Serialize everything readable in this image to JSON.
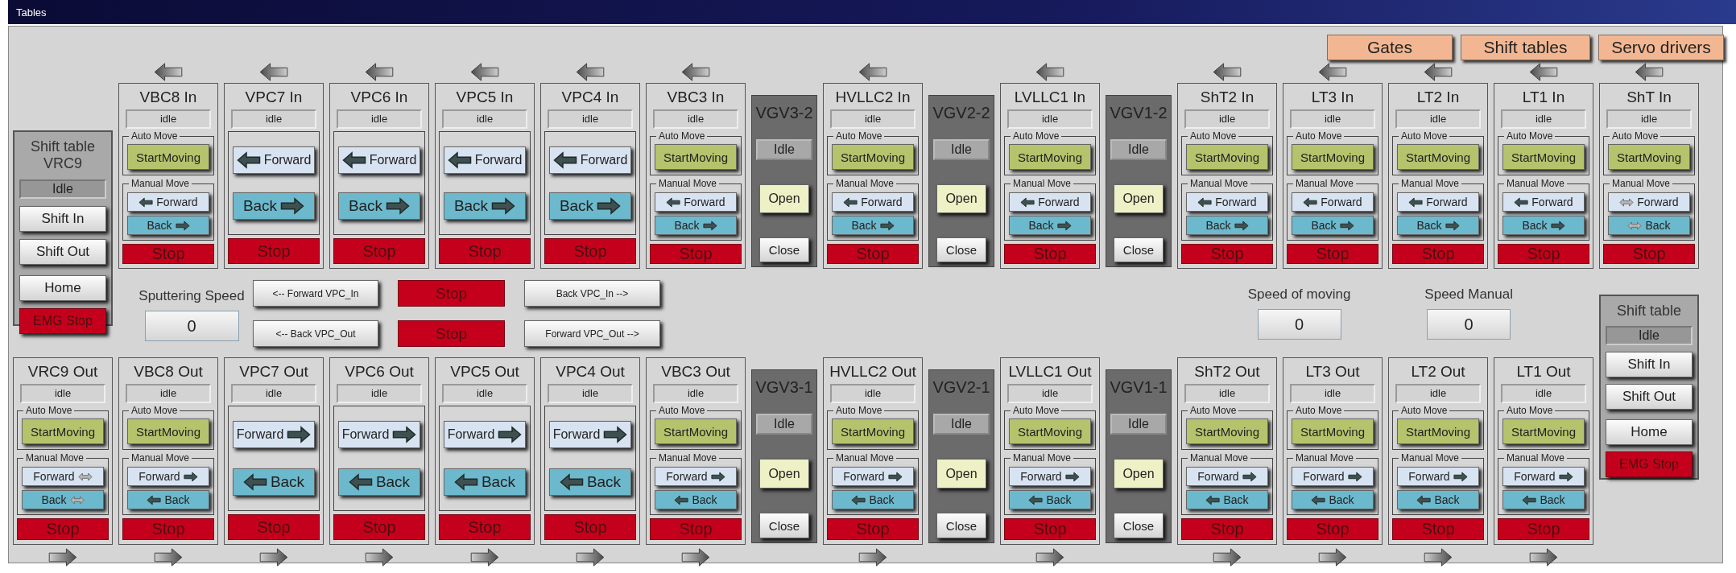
{
  "window": {
    "title": "Tables"
  },
  "nav_buttons": [
    "Gates",
    "Shift tables",
    "Servo drivers"
  ],
  "left_panel": {
    "title": "Shift table VRC9",
    "status": "Idle",
    "buttons": [
      {
        "label": "Shift In",
        "kind": "normal"
      },
      {
        "label": "Shift Out",
        "kind": "normal"
      },
      {
        "label": "Home",
        "kind": "normal"
      },
      {
        "label": "EMG Stop",
        "kind": "emergency"
      }
    ]
  },
  "top": [
    {
      "kind": "auto",
      "title": "VBC8 In",
      "status": "idle",
      "auto_label": "Auto Move",
      "start": "StartMoving",
      "manual_label": "Manual Move",
      "forward": "Forward",
      "back": "Back",
      "stop": "Stop",
      "two_way": false
    },
    {
      "kind": "simple",
      "title": "VPC7 In",
      "status": "idle",
      "forward": "Forward",
      "back": "Back",
      "stop": "Stop",
      "two_way": false
    },
    {
      "kind": "simple",
      "title": "VPC6 In",
      "status": "idle",
      "forward": "Forward",
      "back": "Back",
      "stop": "Stop",
      "two_way": false
    },
    {
      "kind": "simple",
      "title": "VPC5 In",
      "status": "idle",
      "forward": "Forward",
      "back": "Back",
      "stop": "Stop",
      "two_way": false
    },
    {
      "kind": "simple",
      "title": "VPC4 In",
      "status": "idle",
      "forward": "Forward",
      "back": "Back",
      "stop": "Stop",
      "two_way": false
    },
    {
      "kind": "auto",
      "title": "VBC3 In",
      "status": "idle",
      "auto_label": "Auto Move",
      "start": "StartMoving",
      "manual_label": "Manual Move",
      "forward": "Forward",
      "back": "Back",
      "stop": "Stop",
      "two_way": false
    },
    {
      "kind": "valve",
      "title": "VGV3-2",
      "status": "Idle",
      "open": "Open",
      "close": "Close"
    },
    {
      "kind": "auto",
      "title": "HVLLC2 In",
      "status": "idle",
      "auto_label": "Auto Move",
      "start": "StartMoving",
      "manual_label": "Manual Move",
      "forward": "Forward",
      "back": "Back",
      "stop": "Stop",
      "two_way": false
    },
    {
      "kind": "valve",
      "title": "VGV2-2",
      "status": "Idle",
      "open": "Open",
      "close": "Close"
    },
    {
      "kind": "auto",
      "title": "LVLLC1 In",
      "status": "idle",
      "auto_label": "Auto Move",
      "start": "StartMoving",
      "manual_label": "Manual Move",
      "forward": "Forward",
      "back": "Back",
      "stop": "Stop",
      "two_way": false
    },
    {
      "kind": "valve",
      "title": "VGV1-2",
      "status": "Idle",
      "open": "Open",
      "close": "Close"
    },
    {
      "kind": "auto",
      "title": "ShT2 In",
      "status": "idle",
      "auto_label": "Auto Move",
      "start": "StartMoving",
      "manual_label": "Manual Move",
      "forward": "Forward",
      "back": "Back",
      "stop": "Stop",
      "two_way": false
    },
    {
      "kind": "auto",
      "title": "LT3 In",
      "status": "idle",
      "auto_label": "Auto Move",
      "start": "StartMoving",
      "manual_label": "Manual Move",
      "forward": "Forward",
      "back": "Back",
      "stop": "Stop",
      "two_way": false
    },
    {
      "kind": "auto",
      "title": "LT2 In",
      "status": "idle",
      "auto_label": "Auto Move",
      "start": "StartMoving",
      "manual_label": "Manual Move",
      "forward": "Forward",
      "back": "Back",
      "stop": "Stop",
      "two_way": false
    },
    {
      "kind": "auto",
      "title": "LT1 In",
      "status": "idle",
      "auto_label": "Auto Move",
      "start": "StartMoving",
      "manual_label": "Manual Move",
      "forward": "Forward",
      "back": "Back",
      "stop": "Stop",
      "two_way": false
    },
    {
      "kind": "auto",
      "title": "ShT In",
      "status": "idle",
      "auto_label": "Auto Move",
      "start": "StartMoving",
      "manual_label": "Manual Move",
      "forward": "Forward",
      "back": "Back",
      "stop": "Stop",
      "two_way": true
    }
  ],
  "sputtering": {
    "label": "Sputtering Speed",
    "value": "0"
  },
  "commands": [
    {
      "label": "<-- Forward VPC_In",
      "kind": "normal"
    },
    {
      "label": "Stop",
      "kind": "stop"
    },
    {
      "label": "Back VPC_In -->",
      "kind": "normal"
    },
    {
      "label": "<-- Back VPC_Out",
      "kind": "normal"
    },
    {
      "label": "Stop",
      "kind": "stop"
    },
    {
      "label": "Forward VPC_Out -->",
      "kind": "normal"
    }
  ],
  "speeds": [
    {
      "label": "Speed of moving",
      "value": "0"
    },
    {
      "label": "Speed Manual",
      "value": "0"
    }
  ],
  "bottom": [
    {
      "kind": "auto",
      "title": "VRC9 Out",
      "status": "idle",
      "auto_label": "Auto Move",
      "start": "StartMoving",
      "manual_label": "Manual Move",
      "forward": "Forward",
      "back": "Back",
      "stop": "Stop",
      "two_way": true
    },
    {
      "kind": "auto",
      "title": "VBC8 Out",
      "status": "idle",
      "auto_label": "Auto Move",
      "start": "StartMoving",
      "manual_label": "Manual Move",
      "forward": "Forward",
      "back": "Back",
      "stop": "Stop",
      "two_way": false
    },
    {
      "kind": "simple",
      "title": "VPC7 Out",
      "status": "idle",
      "forward": "Forward",
      "back": "Back",
      "stop": "Stop",
      "two_way": false
    },
    {
      "kind": "simple",
      "title": "VPC6 Out",
      "status": "idle",
      "forward": "Forward",
      "back": "Back",
      "stop": "Stop",
      "two_way": false
    },
    {
      "kind": "simple",
      "title": "VPC5 Out",
      "status": "idle",
      "forward": "Forward",
      "back": "Back",
      "stop": "Stop",
      "two_way": false
    },
    {
      "kind": "simple",
      "title": "VPC4 Out",
      "status": "idle",
      "forward": "Forward",
      "back": "Back",
      "stop": "Stop",
      "two_way": false
    },
    {
      "kind": "auto",
      "title": "VBC3 Out",
      "status": "idle",
      "auto_label": "Auto Move",
      "start": "StartMoving",
      "manual_label": "Manual Move",
      "forward": "Forward",
      "back": "Back",
      "stop": "Stop",
      "two_way": false
    },
    {
      "kind": "valve",
      "title": "VGV3-1",
      "status": "Idle",
      "open": "Open",
      "close": "Close"
    },
    {
      "kind": "auto",
      "title": "HVLLC2 Out",
      "status": "idle",
      "auto_label": "Auto Move",
      "start": "StartMoving",
      "manual_label": "Manual Move",
      "forward": "Forward",
      "back": "Back",
      "stop": "Stop",
      "two_way": false
    },
    {
      "kind": "valve",
      "title": "VGV2-1",
      "status": "Idle",
      "open": "Open",
      "close": "Close"
    },
    {
      "kind": "auto",
      "title": "LVLLC1 Out",
      "status": "idle",
      "auto_label": "Auto Move",
      "start": "StartMoving",
      "manual_label": "Manual Move",
      "forward": "Forward",
      "back": "Back",
      "stop": "Stop",
      "two_way": false
    },
    {
      "kind": "valve",
      "title": "VGV1-1",
      "status": "Idle",
      "open": "Open",
      "close": "Close"
    },
    {
      "kind": "auto",
      "title": "ShT2 Out",
      "status": "idle",
      "auto_label": "Auto Move",
      "start": "StartMoving",
      "manual_label": "Manual Move",
      "forward": "Forward",
      "back": "Back",
      "stop": "Stop",
      "two_way": false
    },
    {
      "kind": "auto",
      "title": "LT3 Out",
      "status": "idle",
      "auto_label": "Auto Move",
      "start": "StartMoving",
      "manual_label": "Manual Move",
      "forward": "Forward",
      "back": "Back",
      "stop": "Stop",
      "two_way": false
    },
    {
      "kind": "auto",
      "title": "LT2 Out",
      "status": "idle",
      "auto_label": "Auto Move",
      "start": "StartMoving",
      "manual_label": "Manual Move",
      "forward": "Forward",
      "back": "Back",
      "stop": "Stop",
      "two_way": false
    },
    {
      "kind": "auto",
      "title": "LT1 Out",
      "status": "idle",
      "auto_label": "Auto Move",
      "start": "StartMoving",
      "manual_label": "Manual Move",
      "forward": "Forward",
      "back": "Back",
      "stop": "Stop",
      "two_way": false
    }
  ],
  "right_panel": {
    "title": "Shift table",
    "status": "Idle",
    "buttons": [
      {
        "label": "Shift In",
        "kind": "normal"
      },
      {
        "label": "Shift Out",
        "kind": "normal"
      },
      {
        "label": "Home",
        "kind": "normal"
      },
      {
        "label": "EMG Stop",
        "kind": "emergency"
      }
    ]
  }
}
